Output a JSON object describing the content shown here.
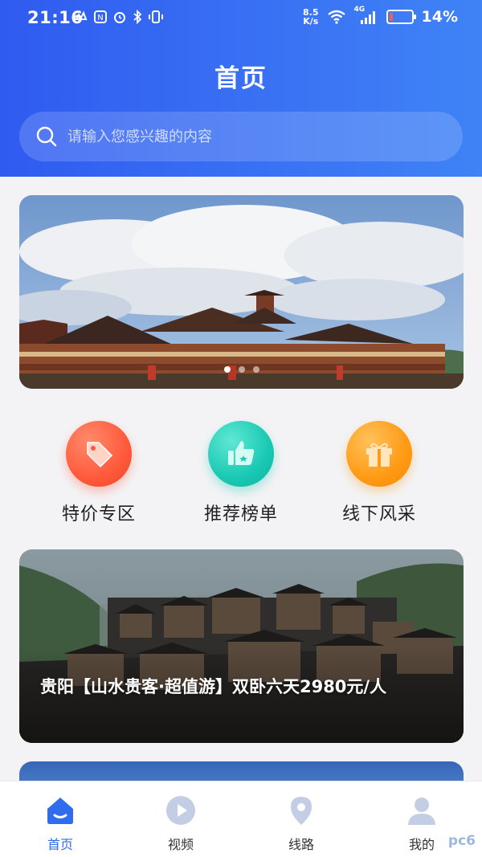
{
  "status_bar": {
    "time": "21:16",
    "net_speed_value": "8.5",
    "net_speed_unit": "K/s",
    "network_label": "4G",
    "battery_percent": "14%",
    "battery_level": 0.14,
    "battery_color": "#ff5a4f",
    "left_icons": [
      "notification-icon",
      "nfc-icon",
      "alarm-icon",
      "bluetooth-icon",
      "vibrate-icon"
    ]
  },
  "header": {
    "title": "首页",
    "gradient": [
      "#2f5bf0",
      "#3f83f6"
    ]
  },
  "search": {
    "placeholder": "请输入您感兴趣的内容"
  },
  "banner": {
    "slide_count": 3,
    "active_slide": 0
  },
  "quick_entries": [
    {
      "label": "特价专区",
      "icon": "price-tag-icon",
      "color": "#ff5a3c"
    },
    {
      "label": "推荐榜单",
      "icon": "thumbs-up-icon",
      "color": "#19c9b3"
    },
    {
      "label": "线下风采",
      "icon": "gift-icon",
      "color": "#ff9a14"
    }
  ],
  "route_card": {
    "title": "贵阳【山水贵客·超值游】双卧六天2980元/人"
  },
  "tabs": [
    {
      "label": "首页",
      "icon": "home-icon",
      "active": true
    },
    {
      "label": "视频",
      "icon": "play-icon",
      "active": false
    },
    {
      "label": "线路",
      "icon": "location-pin-icon",
      "active": false
    },
    {
      "label": "我的",
      "icon": "user-icon",
      "active": false
    }
  ],
  "watermark": "pc6"
}
